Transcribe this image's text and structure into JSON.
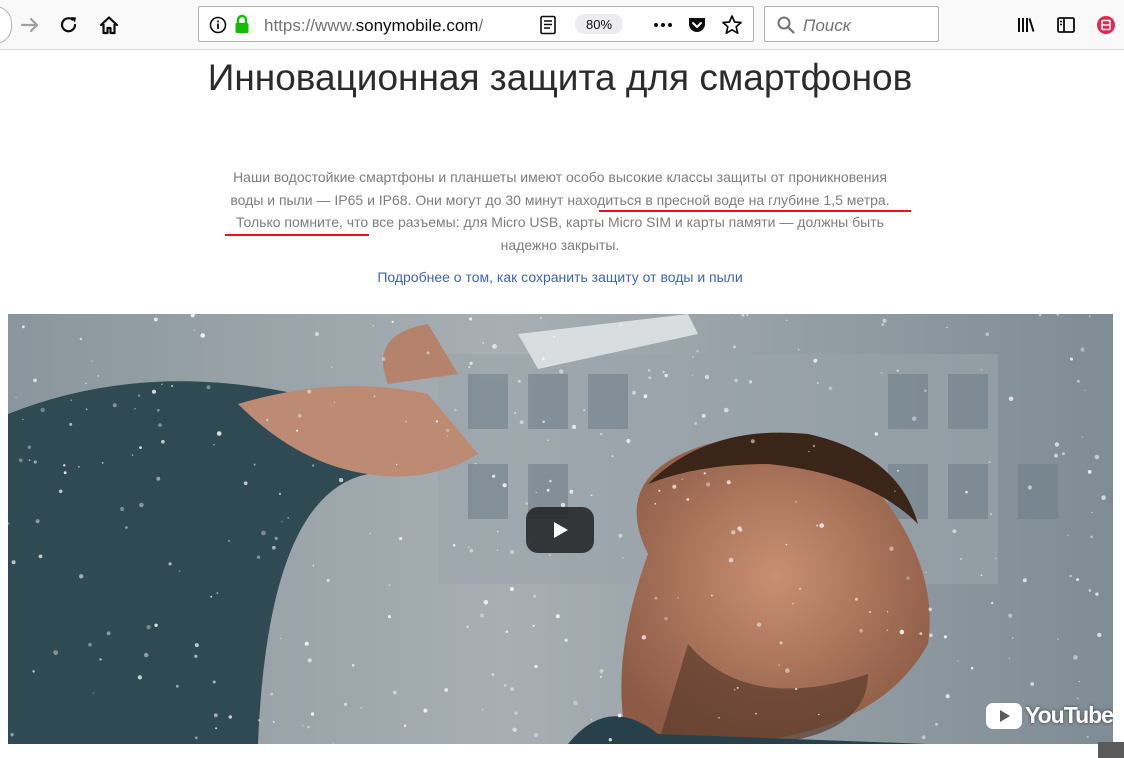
{
  "browser": {
    "url_prefix": "https://www.",
    "url_host": "sonymobile.com",
    "url_rest": "/",
    "zoom": "80%",
    "search_placeholder": "Поиск"
  },
  "page": {
    "title": "Инновационная защита для смартфонов",
    "paragraph_1": "Наши водостойкие смартфоны и планшеты имеют особо высокие классы защиты от проникновения воды и пыли — IP65 и IP68. Они могут ",
    "paragraph_highlight": "до 30 минут находиться в пресной воде на глубине 1,5 метра",
    "paragraph_2": ". Только помните, что все разъемы: для Micro USB, карты Micro SIM и карты памяти — должны быть надежно закрыты.",
    "more_link": "Подробнее о том, как сохранить защиту от воды и пыли"
  },
  "video": {
    "brand": "YouTube"
  },
  "colors": {
    "accent_link": "#3d63c7",
    "underline_mark": "#e8141d",
    "secure_lock": "#12bc00"
  }
}
